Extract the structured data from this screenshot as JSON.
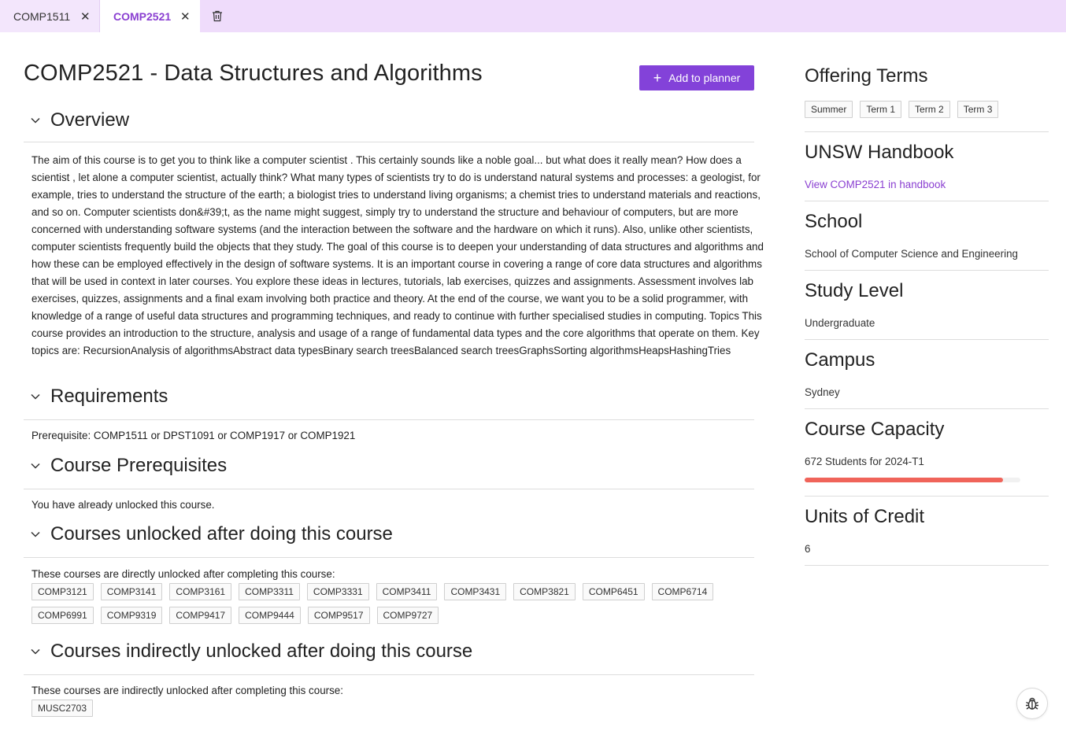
{
  "tabs": [
    {
      "label": "COMP1511",
      "active": false
    },
    {
      "label": "COMP2521",
      "active": true
    }
  ],
  "page": {
    "title": "COMP2521 - Data Structures and Algorithms",
    "add_button": "Add to planner"
  },
  "overview": {
    "heading": "Overview",
    "text": "The aim of this course is to get you to think like a computer scientist . This certainly sounds like a noble goal... but what does it really mean? How does a scientist , let alone a computer scientist, actually think? What many types of scientists try to do is understand natural systems and processes: a geologist, for example, tries to understand the structure of the earth; a biologist tries to understand living organisms; a chemist tries to understand materials and reactions, and so on. Computer scientists don&#39;t, as the name might suggest, simply try to understand the structure and behaviour of computers, but are more concerned with understanding software systems (and the interaction between the software and the hardware on which it runs). Also, unlike other scientists, computer scientists frequently build the objects that they study. The goal of this course is to deepen your understanding of data structures and algorithms and how these can be employed effectively in the design of software systems. It is an important course in covering a range of core data structures and algorithms that will be used in context in later courses. You explore these ideas in lectures, tutorials, lab exercises, quizzes and assignments. Assessment involves lab exercises, quizzes, assignments and a final exam involving both practice and theory. At the end of the course, we want you to be a solid programmer, with knowledge of a range of useful data structures and programming techniques, and ready to continue with further specialised studies in computing. Topics This course provides an introduction to the structure, analysis and usage of a range of fundamental data types and the core algorithms that operate on them. Key topics are: RecursionAnalysis of algorithmsAbstract data typesBinary search treesBalanced search treesGraphsSorting algorithmsHeapsHashingTries"
  },
  "requirements": {
    "heading": "Requirements",
    "text": "Prerequisite: COMP1511 or DPST1091 or COMP1917 or COMP1921"
  },
  "prerequisites": {
    "heading": "Course Prerequisites",
    "text": "You have already unlocked this course."
  },
  "unlocked": {
    "heading": "Courses unlocked after doing this course",
    "text": "These courses are directly unlocked after completing this course:",
    "courses": [
      "COMP3121",
      "COMP3141",
      "COMP3161",
      "COMP3311",
      "COMP3331",
      "COMP3411",
      "COMP3431",
      "COMP3821",
      "COMP6451",
      "COMP6714",
      "COMP6991",
      "COMP9319",
      "COMP9417",
      "COMP9444",
      "COMP9517",
      "COMP9727"
    ]
  },
  "indirect": {
    "heading": "Courses indirectly unlocked after doing this course",
    "text": "These courses are indirectly unlocked after completing this course:",
    "courses": [
      "MUSC2703"
    ]
  },
  "sidebar": {
    "offering_terms": {
      "heading": "Offering Terms",
      "terms": [
        "Summer",
        "Term 1",
        "Term 2",
        "Term 3"
      ]
    },
    "handbook": {
      "heading": "UNSW Handbook",
      "link": "View COMP2521 in handbook"
    },
    "school": {
      "heading": "School",
      "value": "School of Computer Science and Engineering"
    },
    "study_level": {
      "heading": "Study Level",
      "value": "Undergraduate"
    },
    "campus": {
      "heading": "Campus",
      "value": "Sydney"
    },
    "capacity": {
      "heading": "Course Capacity",
      "value": "672 Students for 2024-T1",
      "fill_fraction": 0.92
    },
    "units": {
      "heading": "Units of Credit",
      "value": "6"
    }
  },
  "colors": {
    "accent": "#8342d9",
    "tabbar": "#efdcfb",
    "capacity_bar": "#f0645a"
  }
}
